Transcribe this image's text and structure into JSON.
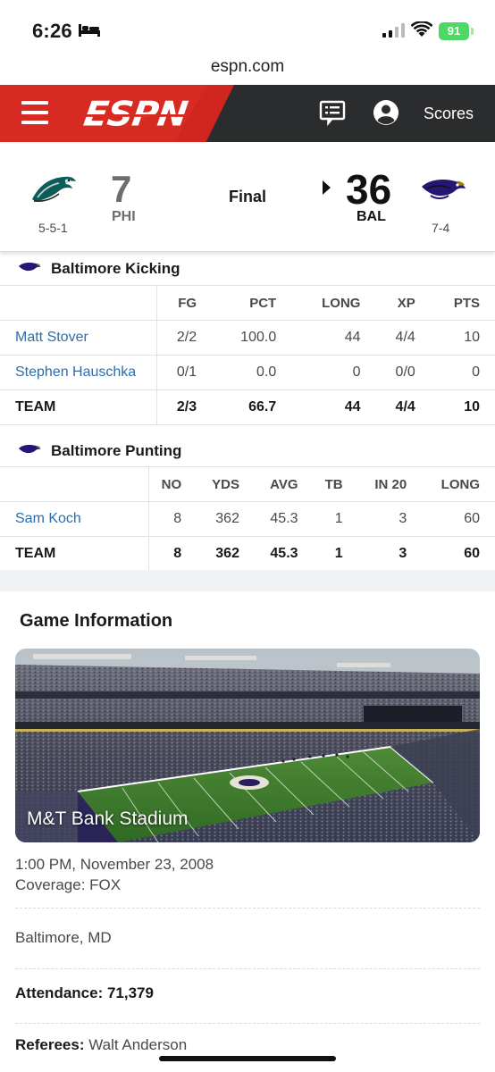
{
  "status_bar": {
    "time": "6:26",
    "battery": "91"
  },
  "browser": {
    "url": "espn.com"
  },
  "nav": {
    "brand": "ESPN",
    "scores_label": "Scores",
    "menu_icon": "hamburger-icon",
    "comments_icon": "comments-icon",
    "profile_icon": "profile-icon"
  },
  "scoreboard": {
    "away": {
      "abbr": "PHI",
      "score": "7",
      "record": "5-5-1",
      "logo_icon": "eagles-logo"
    },
    "status": "Final",
    "home": {
      "abbr": "BAL",
      "score": "36",
      "record": "7-4",
      "logo_icon": "ravens-logo"
    },
    "winner_indicator_icon": "triangle-right-icon"
  },
  "kicking": {
    "title": "Baltimore Kicking",
    "columns": [
      "FG",
      "PCT",
      "LONG",
      "XP",
      "PTS"
    ],
    "rows": [
      {
        "name": "Matt Stover",
        "values": [
          "2/2",
          "100.0",
          "44",
          "4/4",
          "10"
        ]
      },
      {
        "name": "Stephen Hauschka",
        "values": [
          "0/1",
          "0.0",
          "0",
          "0/0",
          "0"
        ]
      }
    ],
    "total": {
      "name": "TEAM",
      "values": [
        "2/3",
        "66.7",
        "44",
        "4/4",
        "10"
      ]
    }
  },
  "punting": {
    "title": "Baltimore Punting",
    "columns": [
      "NO",
      "YDS",
      "AVG",
      "TB",
      "IN 20",
      "LONG"
    ],
    "rows": [
      {
        "name": "Sam Koch",
        "values": [
          "8",
          "362",
          "45.3",
          "1",
          "3",
          "60"
        ]
      }
    ],
    "total": {
      "name": "TEAM",
      "values": [
        "8",
        "362",
        "45.3",
        "1",
        "3",
        "60"
      ]
    }
  },
  "game_info": {
    "title": "Game Information",
    "venue": "M&T Bank Stadium",
    "datetime": "1:00 PM, November 23, 2008",
    "coverage": "Coverage: FOX",
    "location": "Baltimore, MD",
    "attendance": "Attendance: 71,379",
    "referees_label": "Referees:",
    "referees_value": "Walt Anderson"
  },
  "colors": {
    "espn_red": "#d72a22",
    "nav_dark": "#2b2c2d",
    "link_blue": "#2b6dad",
    "field_green": "#3e7a2e"
  }
}
